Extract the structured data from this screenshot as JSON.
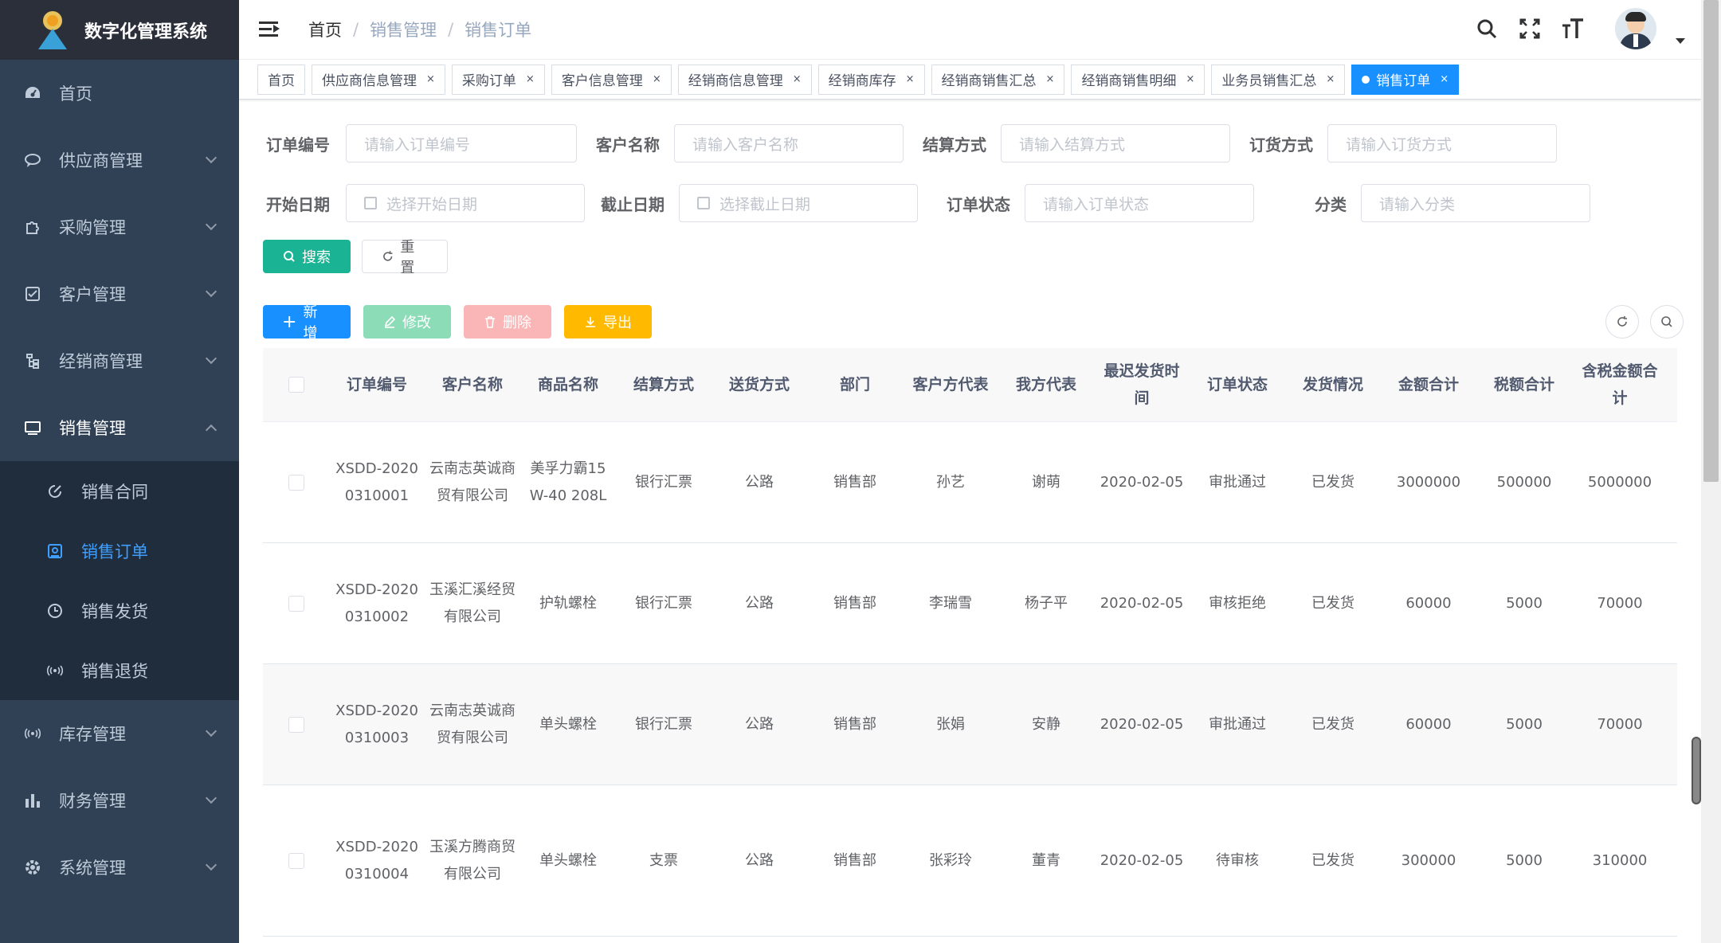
{
  "app": {
    "title": "数字化管理系统"
  },
  "sidebar": {
    "items": [
      {
        "label": "首页",
        "icon": "dashboard-icon"
      },
      {
        "label": "供应商管理",
        "icon": "chat-icon"
      },
      {
        "label": "采购管理",
        "icon": "puzzle-icon"
      },
      {
        "label": "客户管理",
        "icon": "checkbox-icon"
      },
      {
        "label": "经销商管理",
        "icon": "tree-icon"
      },
      {
        "label": "销售管理",
        "icon": "monitor-icon"
      }
    ],
    "sub_items": [
      {
        "label": "销售合同",
        "icon": "edit-icon"
      },
      {
        "label": "销售订单",
        "icon": "order-icon"
      },
      {
        "label": "销售发货",
        "icon": "clock-icon"
      },
      {
        "label": "销售退货",
        "icon": "signal-icon"
      }
    ],
    "bottom_items": [
      {
        "label": "库存管理",
        "icon": "signal-icon"
      },
      {
        "label": "财务管理",
        "icon": "chart-icon"
      },
      {
        "label": "系统管理",
        "icon": "gear-icon"
      }
    ]
  },
  "breadcrumb": {
    "home": "首页",
    "level1": "销售管理",
    "level2": "销售订单",
    "sep": "/"
  },
  "tags": [
    {
      "label": "首页"
    },
    {
      "label": "供应商信息管理"
    },
    {
      "label": "采购订单"
    },
    {
      "label": "客户信息管理"
    },
    {
      "label": "经销商信息管理"
    },
    {
      "label": "经销商库存"
    },
    {
      "label": "经销商销售汇总"
    },
    {
      "label": "经销商销售明细"
    },
    {
      "label": "业务员销售汇总"
    },
    {
      "label": "销售订单"
    }
  ],
  "tag_close": "×",
  "filters": {
    "order_no": {
      "label": "订单编号",
      "placeholder": "请输入订单编号"
    },
    "customer": {
      "label": "客户名称",
      "placeholder": "请输入客户名称"
    },
    "settlement": {
      "label": "结算方式",
      "placeholder": "请输入结算方式"
    },
    "order_method": {
      "label": "订货方式",
      "placeholder": "请输入订货方式"
    },
    "start_date": {
      "label": "开始日期",
      "placeholder": "选择开始日期"
    },
    "end_date": {
      "label": "截止日期",
      "placeholder": "选择截止日期"
    },
    "status": {
      "label": "订单状态",
      "placeholder": "请输入订单状态"
    },
    "category": {
      "label": "分类",
      "placeholder": "请输入分类"
    }
  },
  "buttons": {
    "search": "搜索",
    "reset": "重置",
    "add": "新增",
    "edit": "修改",
    "delete": "删除",
    "export": "导出"
  },
  "table": {
    "columns": [
      "订单编号",
      "客户名称",
      "商品名称",
      "结算方式",
      "送货方式",
      "部门",
      "客户方代表",
      "我方代表",
      "最迟发货时间",
      "订单状态",
      "发货情况",
      "金额合计",
      "税额合计",
      "含税金额合计"
    ],
    "rows": [
      [
        "XSDD-20200310001",
        "云南志英诚商贸有限公司",
        "美孚力霸15W-40 208L",
        "银行汇票",
        "公路",
        "销售部",
        "孙艺",
        "谢萌",
        "2020-02-05",
        "审批通过",
        "已发货",
        "3000000",
        "500000",
        "5000000"
      ],
      [
        "XSDD-20200310002",
        "玉溪汇溪经贸有限公司",
        "护轨螺栓",
        "银行汇票",
        "公路",
        "销售部",
        "李瑞雪",
        "杨子平",
        "2020-02-05",
        "审核拒绝",
        "已发货",
        "60000",
        "5000",
        "70000"
      ],
      [
        "XSDD-20200310003",
        "云南志英诚商贸有限公司",
        "单头螺栓",
        "银行汇票",
        "公路",
        "销售部",
        "张娟",
        "安静",
        "2020-02-05",
        "审批通过",
        "已发货",
        "60000",
        "5000",
        "70000"
      ],
      [
        "XSDD-20200310004",
        "玉溪方腾商贸有限公司",
        "单头螺栓",
        "支票",
        "公路",
        "销售部",
        "张彩玲",
        "董青",
        "2020-02-05",
        "待审核",
        "已发货",
        "300000",
        "5000",
        "310000"
      ]
    ]
  },
  "colors": {
    "sidebar_bg": "#304156",
    "active": "#409eff",
    "teal": "#1ab394",
    "primary": "#1890ff"
  }
}
